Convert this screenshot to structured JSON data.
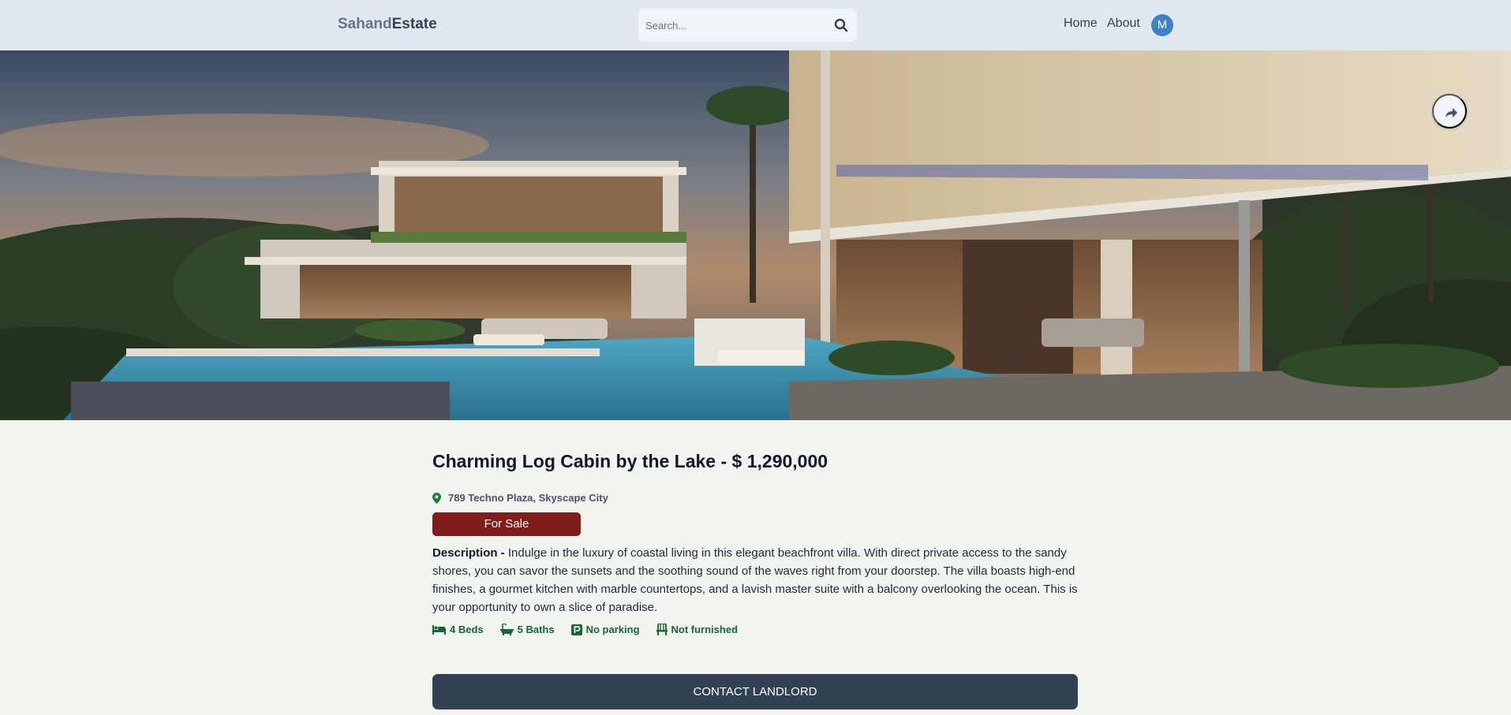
{
  "header": {
    "logo_part1": "Sahand",
    "logo_part2": "Estate",
    "search_placeholder": "Search...",
    "search_icon": "search-icon",
    "nav": {
      "home": "Home",
      "about": "About"
    },
    "avatar_initial": "M"
  },
  "hero": {
    "image": "modern-villa-with-pool",
    "share_icon": "share-icon"
  },
  "listing": {
    "title": "Charming Log Cabin by the Lake - $ 1,290,000",
    "address_icon": "map-marker-icon",
    "address": "789 Techno Plaza, Skyscape City",
    "status": "For Sale",
    "description_label": "Description -",
    "description": "Indulge in the luxury of coastal living in this elegant beachfront villa. With direct private access to the sandy shores, you can savor the sunsets and the soothing sound of the waves right from your doorstep. The villa boasts high-end finishes, a gourmet kitchen with marble countertops, and a lavish master suite with a balcony overlooking the ocean. This is your opportunity to own a slice of paradise.",
    "features": [
      {
        "icon": "bed-icon",
        "label": "4 Beds"
      },
      {
        "icon": "bath-icon",
        "label": "5 Baths"
      },
      {
        "icon": "parking-icon",
        "label": "No parking"
      },
      {
        "icon": "chair-icon",
        "label": "Not furnished"
      }
    ],
    "contact_label": "CONTACT LANDLORD"
  },
  "colors": {
    "header_bg": "#e2e8f0",
    "page_bg": "#f2f4f0",
    "badge_bg": "#7f1d1d",
    "feature_text": "#166534",
    "button_bg": "#334155",
    "avatar_bg": "#3b82c6"
  }
}
